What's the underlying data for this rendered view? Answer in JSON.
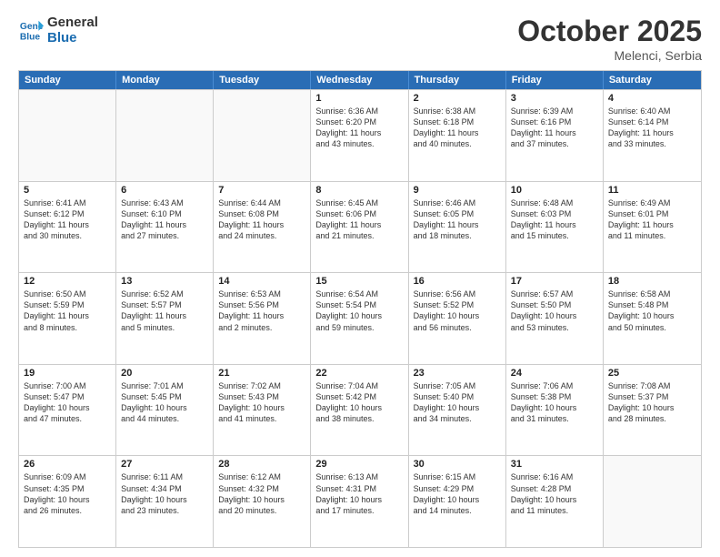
{
  "header": {
    "logo_line1": "General",
    "logo_line2": "Blue",
    "month": "October 2025",
    "location": "Melenci, Serbia"
  },
  "weekdays": [
    "Sunday",
    "Monday",
    "Tuesday",
    "Wednesday",
    "Thursday",
    "Friday",
    "Saturday"
  ],
  "rows": [
    [
      {
        "day": "",
        "text": ""
      },
      {
        "day": "",
        "text": ""
      },
      {
        "day": "",
        "text": ""
      },
      {
        "day": "1",
        "text": "Sunrise: 6:36 AM\nSunset: 6:20 PM\nDaylight: 11 hours\nand 43 minutes."
      },
      {
        "day": "2",
        "text": "Sunrise: 6:38 AM\nSunset: 6:18 PM\nDaylight: 11 hours\nand 40 minutes."
      },
      {
        "day": "3",
        "text": "Sunrise: 6:39 AM\nSunset: 6:16 PM\nDaylight: 11 hours\nand 37 minutes."
      },
      {
        "day": "4",
        "text": "Sunrise: 6:40 AM\nSunset: 6:14 PM\nDaylight: 11 hours\nand 33 minutes."
      }
    ],
    [
      {
        "day": "5",
        "text": "Sunrise: 6:41 AM\nSunset: 6:12 PM\nDaylight: 11 hours\nand 30 minutes."
      },
      {
        "day": "6",
        "text": "Sunrise: 6:43 AM\nSunset: 6:10 PM\nDaylight: 11 hours\nand 27 minutes."
      },
      {
        "day": "7",
        "text": "Sunrise: 6:44 AM\nSunset: 6:08 PM\nDaylight: 11 hours\nand 24 minutes."
      },
      {
        "day": "8",
        "text": "Sunrise: 6:45 AM\nSunset: 6:06 PM\nDaylight: 11 hours\nand 21 minutes."
      },
      {
        "day": "9",
        "text": "Sunrise: 6:46 AM\nSunset: 6:05 PM\nDaylight: 11 hours\nand 18 minutes."
      },
      {
        "day": "10",
        "text": "Sunrise: 6:48 AM\nSunset: 6:03 PM\nDaylight: 11 hours\nand 15 minutes."
      },
      {
        "day": "11",
        "text": "Sunrise: 6:49 AM\nSunset: 6:01 PM\nDaylight: 11 hours\nand 11 minutes."
      }
    ],
    [
      {
        "day": "12",
        "text": "Sunrise: 6:50 AM\nSunset: 5:59 PM\nDaylight: 11 hours\nand 8 minutes."
      },
      {
        "day": "13",
        "text": "Sunrise: 6:52 AM\nSunset: 5:57 PM\nDaylight: 11 hours\nand 5 minutes."
      },
      {
        "day": "14",
        "text": "Sunrise: 6:53 AM\nSunset: 5:56 PM\nDaylight: 11 hours\nand 2 minutes."
      },
      {
        "day": "15",
        "text": "Sunrise: 6:54 AM\nSunset: 5:54 PM\nDaylight: 10 hours\nand 59 minutes."
      },
      {
        "day": "16",
        "text": "Sunrise: 6:56 AM\nSunset: 5:52 PM\nDaylight: 10 hours\nand 56 minutes."
      },
      {
        "day": "17",
        "text": "Sunrise: 6:57 AM\nSunset: 5:50 PM\nDaylight: 10 hours\nand 53 minutes."
      },
      {
        "day": "18",
        "text": "Sunrise: 6:58 AM\nSunset: 5:48 PM\nDaylight: 10 hours\nand 50 minutes."
      }
    ],
    [
      {
        "day": "19",
        "text": "Sunrise: 7:00 AM\nSunset: 5:47 PM\nDaylight: 10 hours\nand 47 minutes."
      },
      {
        "day": "20",
        "text": "Sunrise: 7:01 AM\nSunset: 5:45 PM\nDaylight: 10 hours\nand 44 minutes."
      },
      {
        "day": "21",
        "text": "Sunrise: 7:02 AM\nSunset: 5:43 PM\nDaylight: 10 hours\nand 41 minutes."
      },
      {
        "day": "22",
        "text": "Sunrise: 7:04 AM\nSunset: 5:42 PM\nDaylight: 10 hours\nand 38 minutes."
      },
      {
        "day": "23",
        "text": "Sunrise: 7:05 AM\nSunset: 5:40 PM\nDaylight: 10 hours\nand 34 minutes."
      },
      {
        "day": "24",
        "text": "Sunrise: 7:06 AM\nSunset: 5:38 PM\nDaylight: 10 hours\nand 31 minutes."
      },
      {
        "day": "25",
        "text": "Sunrise: 7:08 AM\nSunset: 5:37 PM\nDaylight: 10 hours\nand 28 minutes."
      }
    ],
    [
      {
        "day": "26",
        "text": "Sunrise: 6:09 AM\nSunset: 4:35 PM\nDaylight: 10 hours\nand 26 minutes."
      },
      {
        "day": "27",
        "text": "Sunrise: 6:11 AM\nSunset: 4:34 PM\nDaylight: 10 hours\nand 23 minutes."
      },
      {
        "day": "28",
        "text": "Sunrise: 6:12 AM\nSunset: 4:32 PM\nDaylight: 10 hours\nand 20 minutes."
      },
      {
        "day": "29",
        "text": "Sunrise: 6:13 AM\nSunset: 4:31 PM\nDaylight: 10 hours\nand 17 minutes."
      },
      {
        "day": "30",
        "text": "Sunrise: 6:15 AM\nSunset: 4:29 PM\nDaylight: 10 hours\nand 14 minutes."
      },
      {
        "day": "31",
        "text": "Sunrise: 6:16 AM\nSunset: 4:28 PM\nDaylight: 10 hours\nand 11 minutes."
      },
      {
        "day": "",
        "text": ""
      }
    ]
  ]
}
